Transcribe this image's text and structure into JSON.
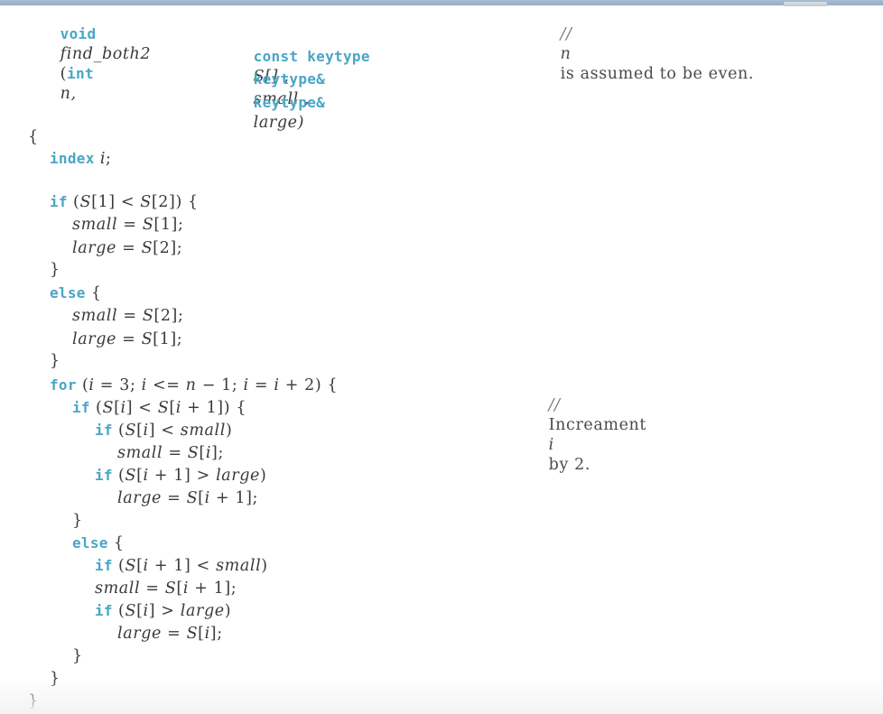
{
  "colors": {
    "keyword": "#4aa6c6",
    "text": "#3a3a3a",
    "topbar": "#9fb3ca"
  },
  "code": {
    "signature": {
      "ret": "void",
      "name": "find_both2",
      "open": "(",
      "p1_type": "int",
      "p1_name": "n,",
      "p2_type": "const keytype",
      "p2_name": "S[] ,",
      "p3_type": "keytype&",
      "p3_name": "small ,",
      "p4_type": "keytype&",
      "p4_name": "large)",
      "comment_slash": "//",
      "comment_var": "n",
      "comment_text": "is assumed to be even."
    },
    "lines": [
      {
        "kw": "",
        "text": "{"
      },
      {
        "kw": "index",
        "text": "i;"
      },
      {
        "kw": "if",
        "text": "(S[1] < S[2]) {"
      },
      {
        "kw": "",
        "text": "small = S[1];"
      },
      {
        "kw": "",
        "text": "large = S[2];"
      },
      {
        "kw": "",
        "text": "}"
      },
      {
        "kw": "else",
        "text": "{"
      },
      {
        "kw": "",
        "text": "small = S[2];"
      },
      {
        "kw": "",
        "text": "large = S[1];"
      },
      {
        "kw": "",
        "text": "}"
      },
      {
        "kw": "for",
        "text": "(i = 3; i <= n − 1; i = i + 2) {"
      },
      {
        "kw": "if",
        "text": "(S[i] < S[i + 1]) {"
      },
      {
        "kw": "if",
        "text": "(S[i] < small)"
      },
      {
        "kw": "",
        "text": "small = S[i];"
      },
      {
        "kw": "if",
        "text": "(S[i + 1] > large)"
      },
      {
        "kw": "",
        "text": "large = S[i + 1];"
      },
      {
        "kw": "",
        "text": "}"
      },
      {
        "kw": "else",
        "text": "{"
      },
      {
        "kw": "if",
        "text": "(S[i + 1] < small)"
      },
      {
        "kw": "",
        "text": "small = S[i + 1];"
      },
      {
        "kw": "if",
        "text": "(S[i] > large)"
      },
      {
        "kw": "",
        "text": "large = S[i];"
      },
      {
        "kw": "",
        "text": "}"
      },
      {
        "kw": "",
        "text": "}"
      },
      {
        "kw": "",
        "text": "}"
      }
    ],
    "for_comment": {
      "slash": "//",
      "before": "Increament",
      "var": "i",
      "after": "by 2."
    }
  }
}
